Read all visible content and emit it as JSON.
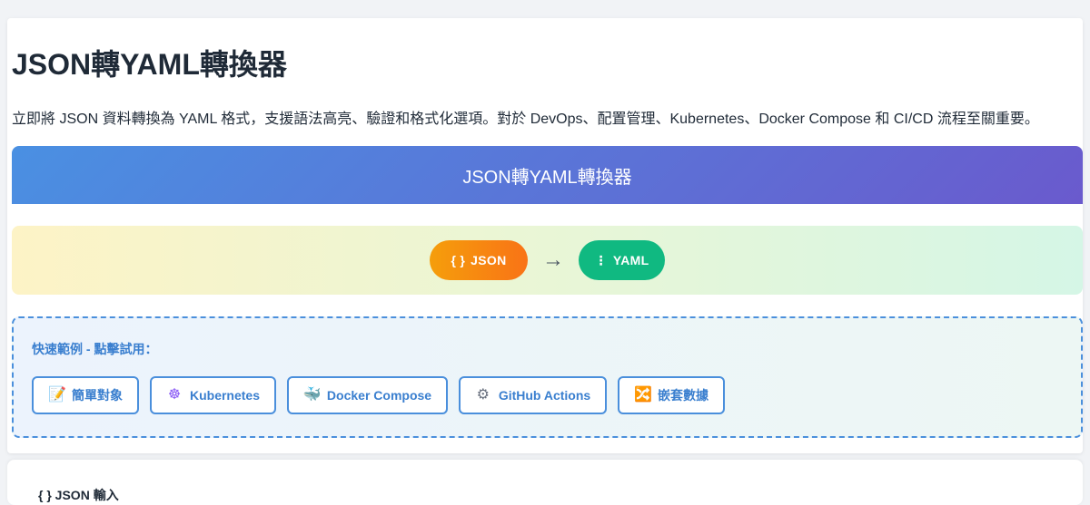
{
  "header": {
    "title": "JSON轉YAML轉換器",
    "description": "立即將 JSON 資料轉換為 YAML 格式，支援語法高亮、驗證和格式化選項。對於 DevOps、配置管理、Kubernetes、Docker Compose 和 CI/CD 流程至關重要。"
  },
  "banner": {
    "title": "JSON轉YAML轉換器"
  },
  "direction": {
    "from_icon": "{ }",
    "from_label": "JSON",
    "arrow": "→",
    "to_icon": "⋮",
    "to_label": "YAML"
  },
  "examples": {
    "title": "快速範例 - 點擊試用：",
    "items": [
      {
        "icon": "📝",
        "icon_name": "memo-icon",
        "label": "簡單對象"
      },
      {
        "icon": "☸",
        "icon_name": "kubernetes-icon",
        "label": "Kubernetes"
      },
      {
        "icon": "🐳",
        "icon_name": "whale-icon",
        "label": "Docker Compose"
      },
      {
        "icon": "⚙",
        "icon_name": "gear-icon",
        "label": "GitHub Actions"
      },
      {
        "icon": "🔀",
        "icon_name": "shuffle-icon",
        "label": "嵌套數據"
      }
    ]
  },
  "input_section": {
    "heading": "{ } JSON 輸入"
  },
  "colors": {
    "accent": "#4a8fdc",
    "banner_start": "#4a90e2",
    "banner_end": "#6a5acd",
    "json_pill": "#f97316",
    "yaml_pill": "#10b981"
  }
}
